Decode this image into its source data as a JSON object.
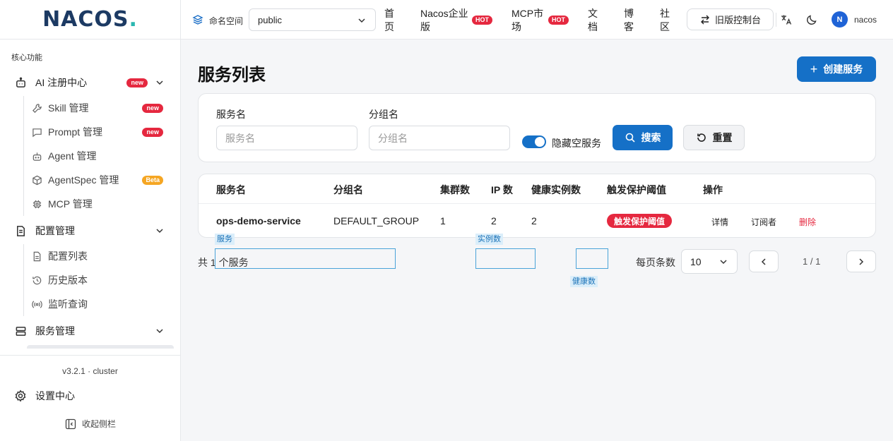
{
  "sidebar": {
    "logo_main": "NACOS",
    "logo_dot": ".",
    "section_title": "核心功能",
    "groups": [
      {
        "label": "AI 注册中心",
        "badge": "new"
      },
      {
        "label": "配置管理"
      },
      {
        "label": "服务管理"
      }
    ],
    "ai_items": [
      {
        "label": "Skill 管理",
        "badge": "new"
      },
      {
        "label": "Prompt 管理",
        "badge": "new"
      },
      {
        "label": "Agent 管理"
      },
      {
        "label": "AgentSpec 管理",
        "badge": "Beta"
      },
      {
        "label": "MCP 管理"
      }
    ],
    "config_items": [
      {
        "label": "配置列表"
      },
      {
        "label": "历史版本"
      },
      {
        "label": "监听查询"
      }
    ],
    "version": "v3.2.1 · cluster",
    "settings_label": "设置中心",
    "collapse_label": "收起侧栏"
  },
  "header": {
    "namespace_label": "命名空间",
    "namespace_value": "public",
    "nav": [
      {
        "label": "首页"
      },
      {
        "label": "Nacos企业版",
        "badge": "HOT"
      },
      {
        "label": "MCP市场",
        "badge": "HOT"
      },
      {
        "label": "文档"
      },
      {
        "label": "博客"
      },
      {
        "label": "社区"
      }
    ],
    "old_console_label": "旧版控制台",
    "avatar_initial": "N",
    "username": "nacos"
  },
  "main": {
    "title": "服务列表",
    "create_button": "创建服务",
    "filter": {
      "service_name_label": "服务名",
      "service_name_placeholder": "服务名",
      "group_name_label": "分组名",
      "group_name_placeholder": "分组名",
      "hide_empty_label": "隐藏空服务",
      "hide_empty_on": true,
      "search_button": "搜索",
      "reset_button": "重置"
    },
    "table": {
      "columns": [
        "服务名",
        "分组名",
        "集群数",
        "IP 数",
        "健康实例数",
        "触发保护阈值",
        "操作"
      ],
      "rows": [
        {
          "service_name": "ops-demo-service",
          "group_name": "DEFAULT_GROUP",
          "clusters": "1",
          "ips": "2",
          "healthy": "2",
          "threshold": "触发保护阈值",
          "actions": [
            "详情",
            "订阅者",
            "删除"
          ]
        }
      ]
    },
    "pager": {
      "total_prefix": "共 1",
      "total_suffix": "个服务",
      "page_size_label": "每页条数",
      "page_size": "10",
      "page_info": "1 / 1"
    }
  },
  "annotations": {
    "service": "服务",
    "instances": "实例数",
    "healthy": "健康数"
  }
}
